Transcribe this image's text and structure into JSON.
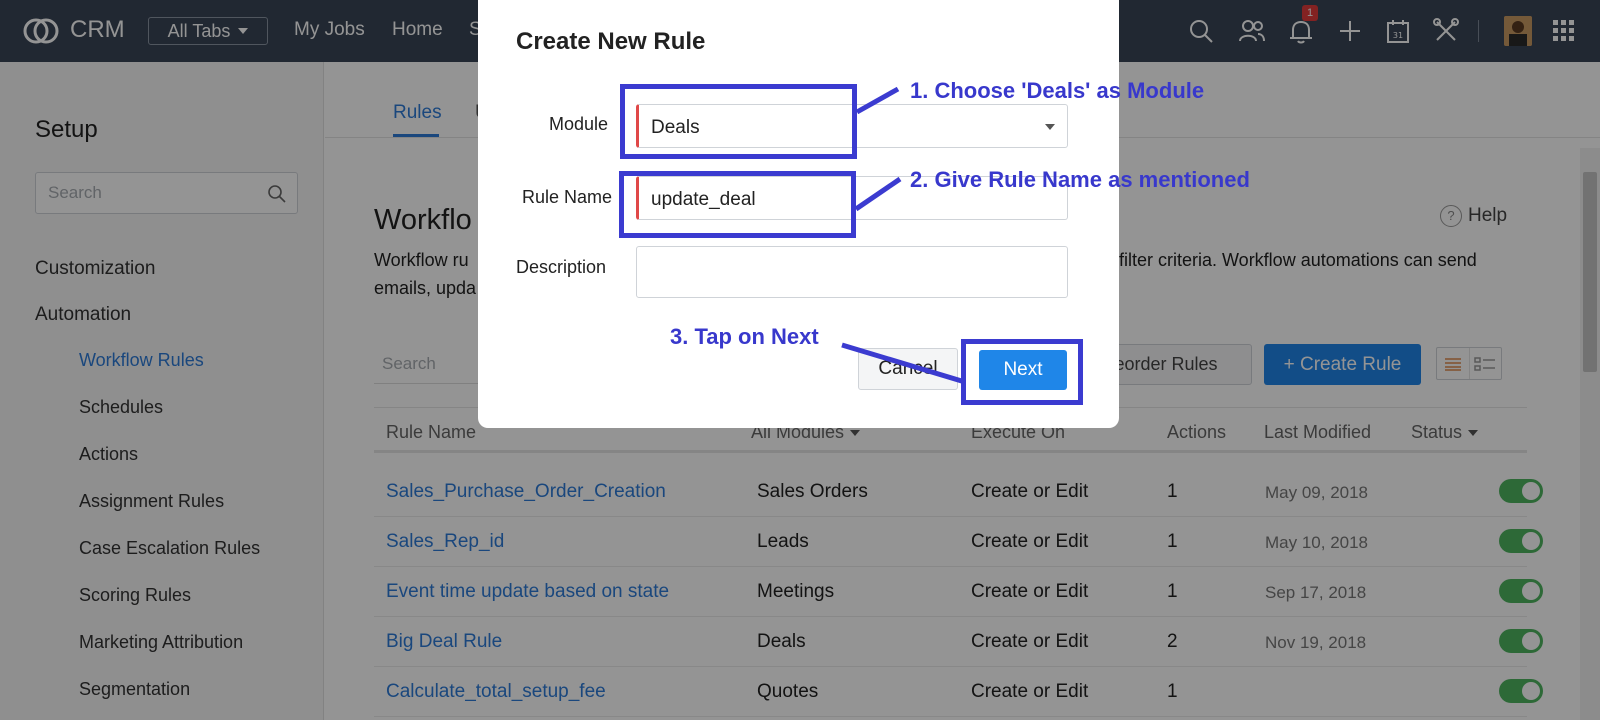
{
  "topbar": {
    "brand": "CRM",
    "all_tabs": "All Tabs",
    "nav": [
      "My Jobs",
      "Home",
      "S"
    ],
    "notification_count": "1"
  },
  "sidebar": {
    "title": "Setup",
    "search_placeholder": "Search",
    "sections": [
      "Customization",
      "Automation"
    ],
    "items": [
      "Workflow Rules",
      "Schedules",
      "Actions",
      "Assignment Rules",
      "Case Escalation Rules",
      "Scoring Rules",
      "Marketing Attribution",
      "Segmentation"
    ],
    "active_item": "Workflow Rules"
  },
  "main": {
    "tab_rules": "Rules",
    "tab_other": "U",
    "title": "Workflo",
    "help": "Help",
    "desc_line1_a": "Workflow ru",
    "desc_line1_b": "filter criteria. Workflow automations can send",
    "desc_line2": "emails, upda",
    "search_placeholder": "Search",
    "reorder_label": "eorder Rules",
    "create_label": "+ Create Rule",
    "columns": {
      "rule_name": "Rule Name",
      "modules": "All Modules",
      "execute_on": "Execute On",
      "actions": "Actions",
      "last_modified": "Last Modified",
      "status": "Status"
    },
    "rows": [
      {
        "name": "Sales_Purchase_Order_Creation",
        "module": "Sales Orders",
        "execute": "Create or Edit",
        "actions": "1",
        "date": "May 09, 2018"
      },
      {
        "name": "Sales_Rep_id",
        "module": "Leads",
        "execute": "Create or Edit",
        "actions": "1",
        "date": "May 10, 2018"
      },
      {
        "name": "Event time update based on state",
        "module": "Meetings",
        "execute": "Create or Edit",
        "actions": "1",
        "date": "Sep 17, 2018"
      },
      {
        "name": "Big Deal Rule",
        "module": "Deals",
        "execute": "Create or Edit",
        "actions": "2",
        "date": "Nov 19, 2018"
      },
      {
        "name": "Calculate_total_setup_fee",
        "module": "Quotes",
        "execute": "Create or Edit",
        "actions": "1",
        "date": ""
      }
    ]
  },
  "modal": {
    "title": "Create New Rule",
    "module_label": "Module",
    "module_value": "Deals",
    "rule_name_label": "Rule Name",
    "rule_name_value": "update_deal",
    "description_label": "Description",
    "description_value": "",
    "cancel": "Cancel",
    "next": "Next"
  },
  "annotations": {
    "step1": "1. Choose 'Deals' as Module",
    "step2": "2. Give Rule Name as mentioned",
    "step3": "3. Tap on Next",
    "color": "#3b3bd0"
  },
  "colors": {
    "topbar": "#394556",
    "accent": "#1f86e8",
    "link": "#2d7bd8",
    "toggle_on": "#4fb560"
  }
}
